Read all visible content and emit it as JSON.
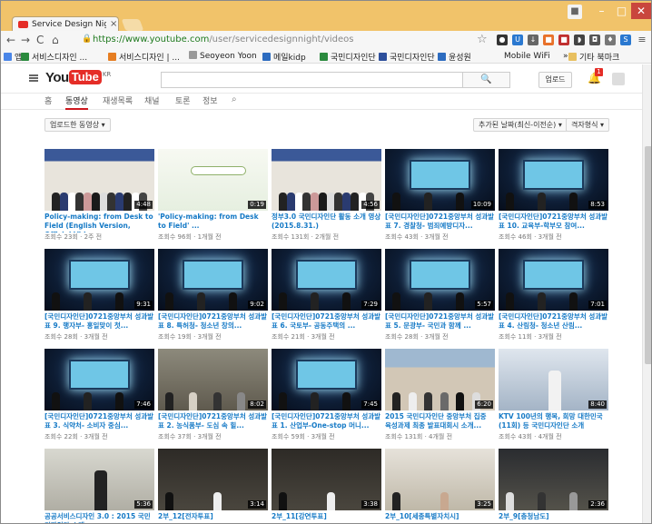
{
  "browser": {
    "tab_title": "Service Design Nigh",
    "tab_close": "×",
    "url_host": "https://www.youtube.com",
    "url_path": "/user/servicedesignnight/videos",
    "bookmarks": [
      {
        "label": "앱",
        "color": "#4a86e8"
      },
      {
        "label": "서비스디자인 ...",
        "color": "#2b8a3e"
      },
      {
        "label": "서비스디자인 | ...",
        "color": "#e67e22"
      },
      {
        "label": "Seoyeon Yoon",
        "color": "#999999"
      },
      {
        "label": "메일kidp",
        "color": "#2d6cc0"
      },
      {
        "label": "국민디자인단",
        "color": "#2b8a3e"
      },
      {
        "label": "국민디자인단",
        "color": "#2d4f9c"
      },
      {
        "label": "윤성원",
        "color": "#2d6cc0"
      },
      {
        "label": "Mobile WiFi",
        "color": "#f6f6f6"
      },
      {
        "label": "»",
        "color": "#f6f6f6"
      },
      {
        "label": "기타 북마크",
        "color": "#e8c060"
      }
    ]
  },
  "youtube": {
    "logo_you": "You",
    "logo_tube": "Tube",
    "logo_kr": "KR",
    "search_icon": "🔍",
    "upload_label": "업로드",
    "notification_count": "1",
    "tabs": [
      "홈",
      "동영상",
      "재생목록",
      "채널",
      "토론",
      "정보"
    ],
    "sort_left": "업로드한 동영상 ▾",
    "sort_date": "추가된 날짜(최신-이전순) ▾",
    "sort_view": "격자형식 ▾"
  },
  "videos": [
    {
      "title": "Policy-making: from Desk to Field (English Version, Official Video...",
      "meta": "조회수 23회 · 2주 전",
      "duration": "4:48",
      "theme": "event"
    },
    {
      "title": "'Policy-making: from Desk to Field' ...",
      "meta": "조회수 96회 · 1개월 전",
      "duration": "0:19",
      "theme": "slide"
    },
    {
      "title": "정부3.0 국민디자인단 활동 소개 영상 (2015.8.31.)",
      "meta": "조회수 131회 · 2개월 전",
      "duration": "4:56",
      "theme": "event"
    },
    {
      "title": "[국민디자인단]0721중앙부처 성과발표 7. 경찰청- 범죄예방디자...",
      "meta": "조회수 43회 · 3개월 전",
      "duration": "10:09",
      "theme": "screen"
    },
    {
      "title": "[국민디자인단]0721중앙부처 성과발표 10. 교육부-학부모 참여...",
      "meta": "조회수 46회 · 3개월 전",
      "duration": "8:53",
      "theme": "screen"
    },
    {
      "title": "[국민디자인단]0721중앙부처 성과발표 9. 행자부- 홍일맞이 첫...",
      "meta": "조회수 28회 · 3개월 전",
      "duration": "9:31",
      "theme": "screen"
    },
    {
      "title": "[국민디자인단]0721중앙부처 성과발표 8. 특허청- 청소년 창의...",
      "meta": "조회수 19회 · 3개월 전",
      "duration": "9:02",
      "theme": "screen"
    },
    {
      "title": "[국민디자인단]0721중앙부처 성과발표 6. 국토부- 공동주택의 ...",
      "meta": "조회수 21회 · 3개월 전",
      "duration": "7:29",
      "theme": "screen"
    },
    {
      "title": "[국민디자인단]0721중앙부처 성과발표 5. 문광부- 국민과 함께 ...",
      "meta": "조회수 28회 · 3개월 전",
      "duration": "5:57",
      "theme": "screen"
    },
    {
      "title": "[국민디자인단]0721중앙부처 성과발표 4. 산림청- 청소년 산림...",
      "meta": "조회수 11회 · 3개월 전",
      "duration": "7:01",
      "theme": "screen"
    },
    {
      "title": "[국민디자인단]0721중앙부처 성과발표 3. 식약처- 소비자 중심...",
      "meta": "조회수 22회 · 3개월 전",
      "duration": "7:46",
      "theme": "screen"
    },
    {
      "title": "[국민디자인단]0721중앙부처 성과발표 2. 농식품부- 도심 속 힐...",
      "meta": "조회수 37회 · 3개월 전",
      "duration": "8:02",
      "theme": "room"
    },
    {
      "title": "[국민디자인단]0721중앙부처 성과발표 1. 산업부-One-stop 머니...",
      "meta": "조회수 59회 · 3개월 전",
      "duration": "7:45",
      "theme": "screen"
    },
    {
      "title": "2015 국민디자인단 중앙부처 집중 육성과제 최종 발표대회시 소개...",
      "meta": "조회수 131회 · 4개월 전",
      "duration": "6:20",
      "theme": "meeting"
    },
    {
      "title": "KTV 100년의 행복, 희망 대한민국 (11회) 등 국민디자인단 소개",
      "meta": "조회수 43회 · 4개월 전",
      "duration": "8:40",
      "theme": "speaker"
    },
    {
      "title": "공공서비스디자인 3.0 : 2015 국민디자인단 소개",
      "meta": "조회수 ...",
      "duration": "5:36",
      "theme": "office"
    },
    {
      "title": "2부_12[전자투표]",
      "meta": "조회수 ... · 5개월 전",
      "duration": "3:14",
      "theme": "stage"
    },
    {
      "title": "2부_11[강연투표]",
      "meta": "조회수 ... · 5개월 전",
      "duration": "3:38",
      "theme": "stage"
    },
    {
      "title": "2부_10[세종특별자치시]",
      "meta": "조회수 ... · 5개월 전",
      "duration": "3:25",
      "theme": "woman"
    },
    {
      "title": "2부_9[충청남도]",
      "meta": "조회수 ... · 5개월 전",
      "duration": "2:36",
      "theme": "hall"
    }
  ]
}
